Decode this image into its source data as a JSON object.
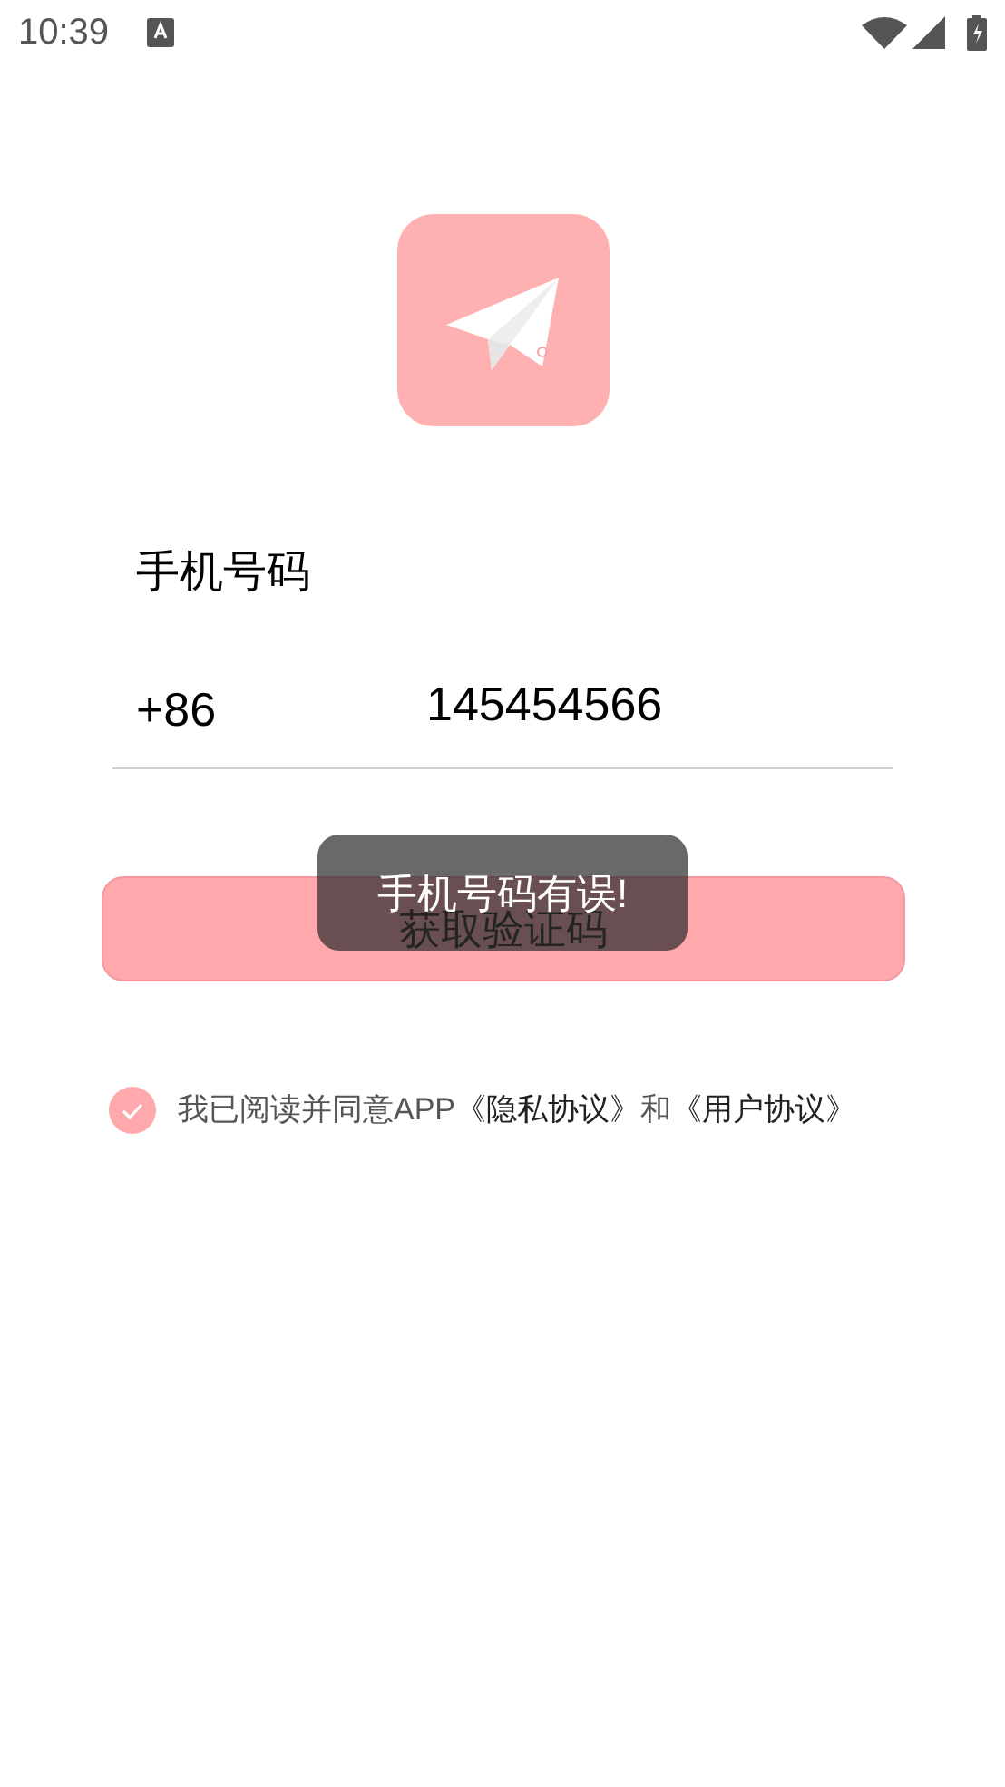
{
  "status_bar": {
    "time": "10:39"
  },
  "form": {
    "label": "手机号码",
    "country_code": "+86",
    "phone": "145454566"
  },
  "button": {
    "label": "获取验证码"
  },
  "toast": {
    "text": "手机号码有误!"
  },
  "agreement": {
    "checked": true,
    "prefix": "我已阅读并同意APP",
    "privacy_link": "《隐私协议》",
    "joiner": "和",
    "user_link": "《用户协议》"
  }
}
